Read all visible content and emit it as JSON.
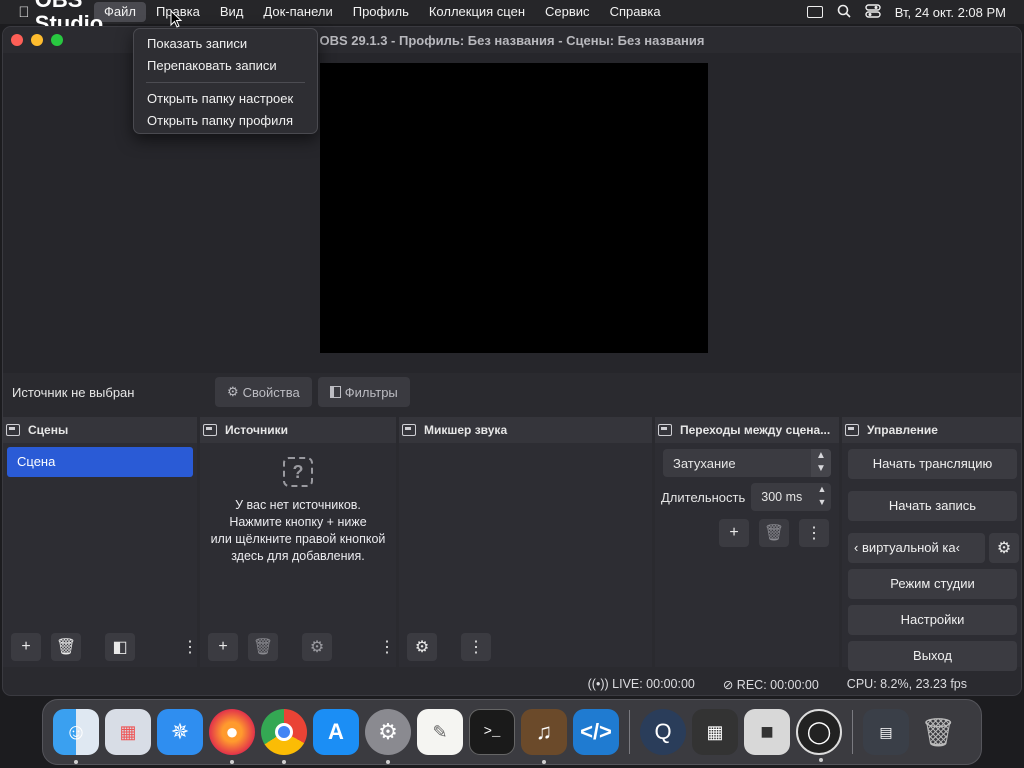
{
  "menubar": {
    "app_name": "OBS Studio",
    "items": [
      "Файл",
      "Правка",
      "Вид",
      "Док-панели",
      "Профиль",
      "Коллекция сцен",
      "Сервис",
      "Справка"
    ],
    "datetime": "Вт, 24 окт.  2:08 PM"
  },
  "window": {
    "title": "OBS 29.1.3 - Профиль: Без названия - Сцены: Без названия"
  },
  "file_menu": {
    "items": [
      "Показать записи",
      "Перепаковать записи",
      "Открыть папку настроек",
      "Открыть папку профиля"
    ]
  },
  "source_bar": {
    "label": "Источник не выбран",
    "properties": "Свойства",
    "filters": "Фильтры"
  },
  "docks": {
    "scenes": {
      "title": "Сцены",
      "items": [
        "Сцена"
      ]
    },
    "sources": {
      "title": "Источники",
      "empty_lines": [
        "У вас нет источников.",
        "Нажмите кнопку + ниже",
        "или щёлкните правой кнопкой",
        "здесь для добавления."
      ]
    },
    "mixer": {
      "title": "Микшер звука"
    },
    "transitions": {
      "title": "Переходы между сцена...",
      "selected": "Затухание",
      "duration_label": "Длительность",
      "duration_value": "300 ms"
    },
    "controls": {
      "title": "Управление",
      "start_stream": "Начать трансляцию",
      "start_record": "Начать запись",
      "virtual_cam": "‹ виртуальной ка‹",
      "studio_mode": "Режим студии",
      "settings": "Настройки",
      "exit": "Выход"
    }
  },
  "status": {
    "live": "LIVE: 00:00:00",
    "rec": "REC: 00:00:00",
    "cpu": "CPU: 8.2%, 23.23 fps"
  },
  "colors": {
    "accent": "#2a5bd6",
    "canvas": "#000000"
  },
  "dock_apps": [
    "Finder",
    "Launchpad",
    "Safari",
    "Firefox",
    "Chrome",
    "App Store",
    "System Settings",
    "TextEdit",
    "Terminal",
    "GarageBand",
    "VS Code",
    "QuickTime",
    "Calculator",
    "Roblox",
    "OBS",
    "Screenshot",
    "Trash"
  ]
}
